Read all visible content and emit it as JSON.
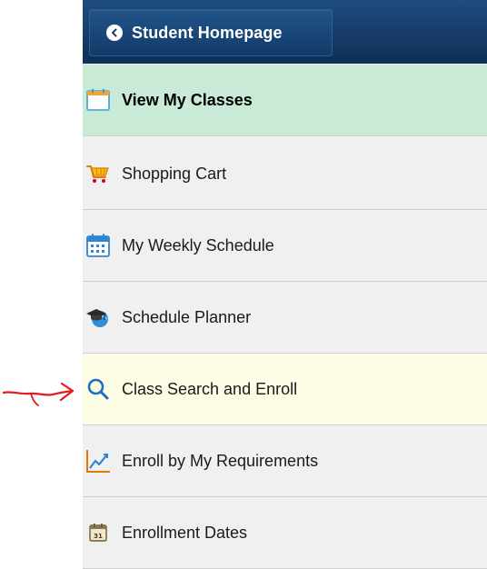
{
  "header": {
    "back_label": "Student Homepage"
  },
  "menu": {
    "items": [
      {
        "label": "View My Classes",
        "icon": "calendar-icon",
        "state": "selected"
      },
      {
        "label": "Shopping Cart",
        "icon": "shopping-cart-icon",
        "state": "normal"
      },
      {
        "label": "My Weekly Schedule",
        "icon": "weekly-calendar-icon",
        "state": "normal"
      },
      {
        "label": "Schedule Planner",
        "icon": "graduation-cap-globe-icon",
        "state": "normal"
      },
      {
        "label": "Class Search and Enroll",
        "icon": "search-icon",
        "state": "highlighted"
      },
      {
        "label": "Enroll by My Requirements",
        "icon": "trend-chart-icon",
        "state": "normal"
      },
      {
        "label": "Enrollment Dates",
        "icon": "calendar-date-icon",
        "state": "normal"
      }
    ]
  },
  "colors": {
    "header": "#173f6b",
    "selected_bg": "#c9ead7",
    "highlight_bg": "#fdfde6",
    "panel_bg": "#f0f0f0",
    "annotation": "#e11d1d"
  }
}
